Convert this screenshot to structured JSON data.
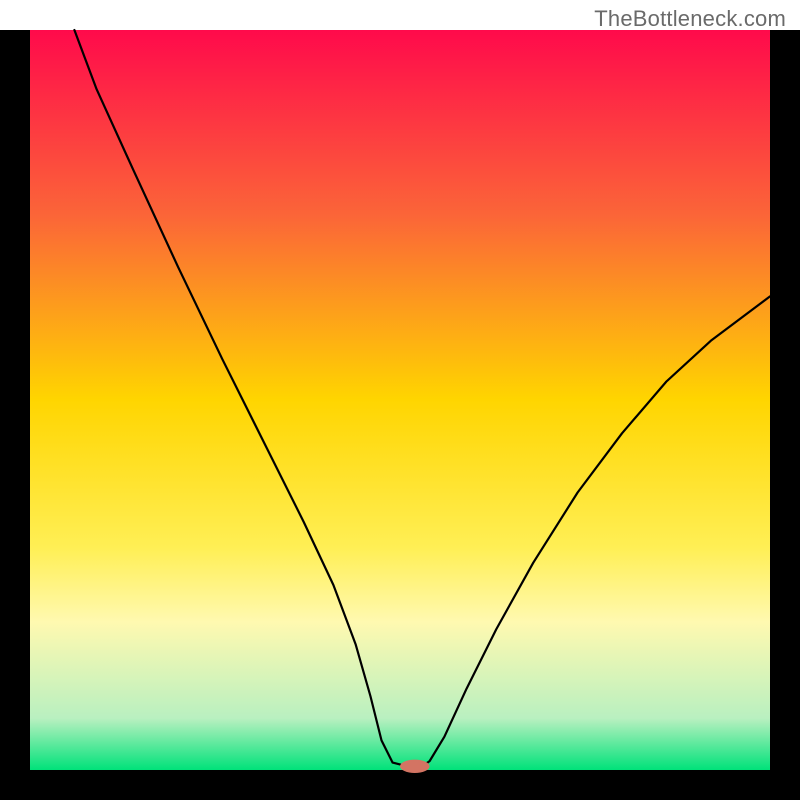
{
  "watermark": "TheBottleneck.com",
  "chart_data": {
    "type": "line",
    "title": "",
    "xlabel": "",
    "ylabel": "",
    "xlim": [
      0,
      100
    ],
    "ylim": [
      0,
      100
    ],
    "background_gradient": {
      "type": "vertical",
      "stops": [
        {
          "offset": 0.0,
          "color": "#ff0a4b"
        },
        {
          "offset": 0.25,
          "color": "#fb6538"
        },
        {
          "offset": 0.5,
          "color": "#ffd500"
        },
        {
          "offset": 0.7,
          "color": "#ffef55"
        },
        {
          "offset": 0.8,
          "color": "#fff9b0"
        },
        {
          "offset": 0.93,
          "color": "#b9f0c0"
        },
        {
          "offset": 1.0,
          "color": "#00e27a"
        }
      ]
    },
    "frame_color": "#000000",
    "curve": {
      "color": "#000000",
      "width": 2.2,
      "points": [
        {
          "x": 6.0,
          "y": 100.0
        },
        {
          "x": 9.0,
          "y": 92.0
        },
        {
          "x": 14.0,
          "y": 81.0
        },
        {
          "x": 20.0,
          "y": 68.0
        },
        {
          "x": 26.0,
          "y": 55.5
        },
        {
          "x": 32.0,
          "y": 43.5
        },
        {
          "x": 37.0,
          "y": 33.5
        },
        {
          "x": 41.0,
          "y": 25.0
        },
        {
          "x": 44.0,
          "y": 17.0
        },
        {
          "x": 46.0,
          "y": 10.0
        },
        {
          "x": 47.5,
          "y": 4.0
        },
        {
          "x": 49.0,
          "y": 1.0
        },
        {
          "x": 51.0,
          "y": 0.5
        },
        {
          "x": 53.0,
          "y": 0.5
        },
        {
          "x": 54.0,
          "y": 1.2
        },
        {
          "x": 56.0,
          "y": 4.5
        },
        {
          "x": 59.0,
          "y": 11.0
        },
        {
          "x": 63.0,
          "y": 19.0
        },
        {
          "x": 68.0,
          "y": 28.0
        },
        {
          "x": 74.0,
          "y": 37.5
        },
        {
          "x": 80.0,
          "y": 45.5
        },
        {
          "x": 86.0,
          "y": 52.5
        },
        {
          "x": 92.0,
          "y": 58.0
        },
        {
          "x": 100.0,
          "y": 64.0
        }
      ]
    },
    "marker": {
      "x": 52.0,
      "y": 0.5,
      "rx": 2.0,
      "ry": 0.9,
      "color": "#d37463"
    }
  }
}
